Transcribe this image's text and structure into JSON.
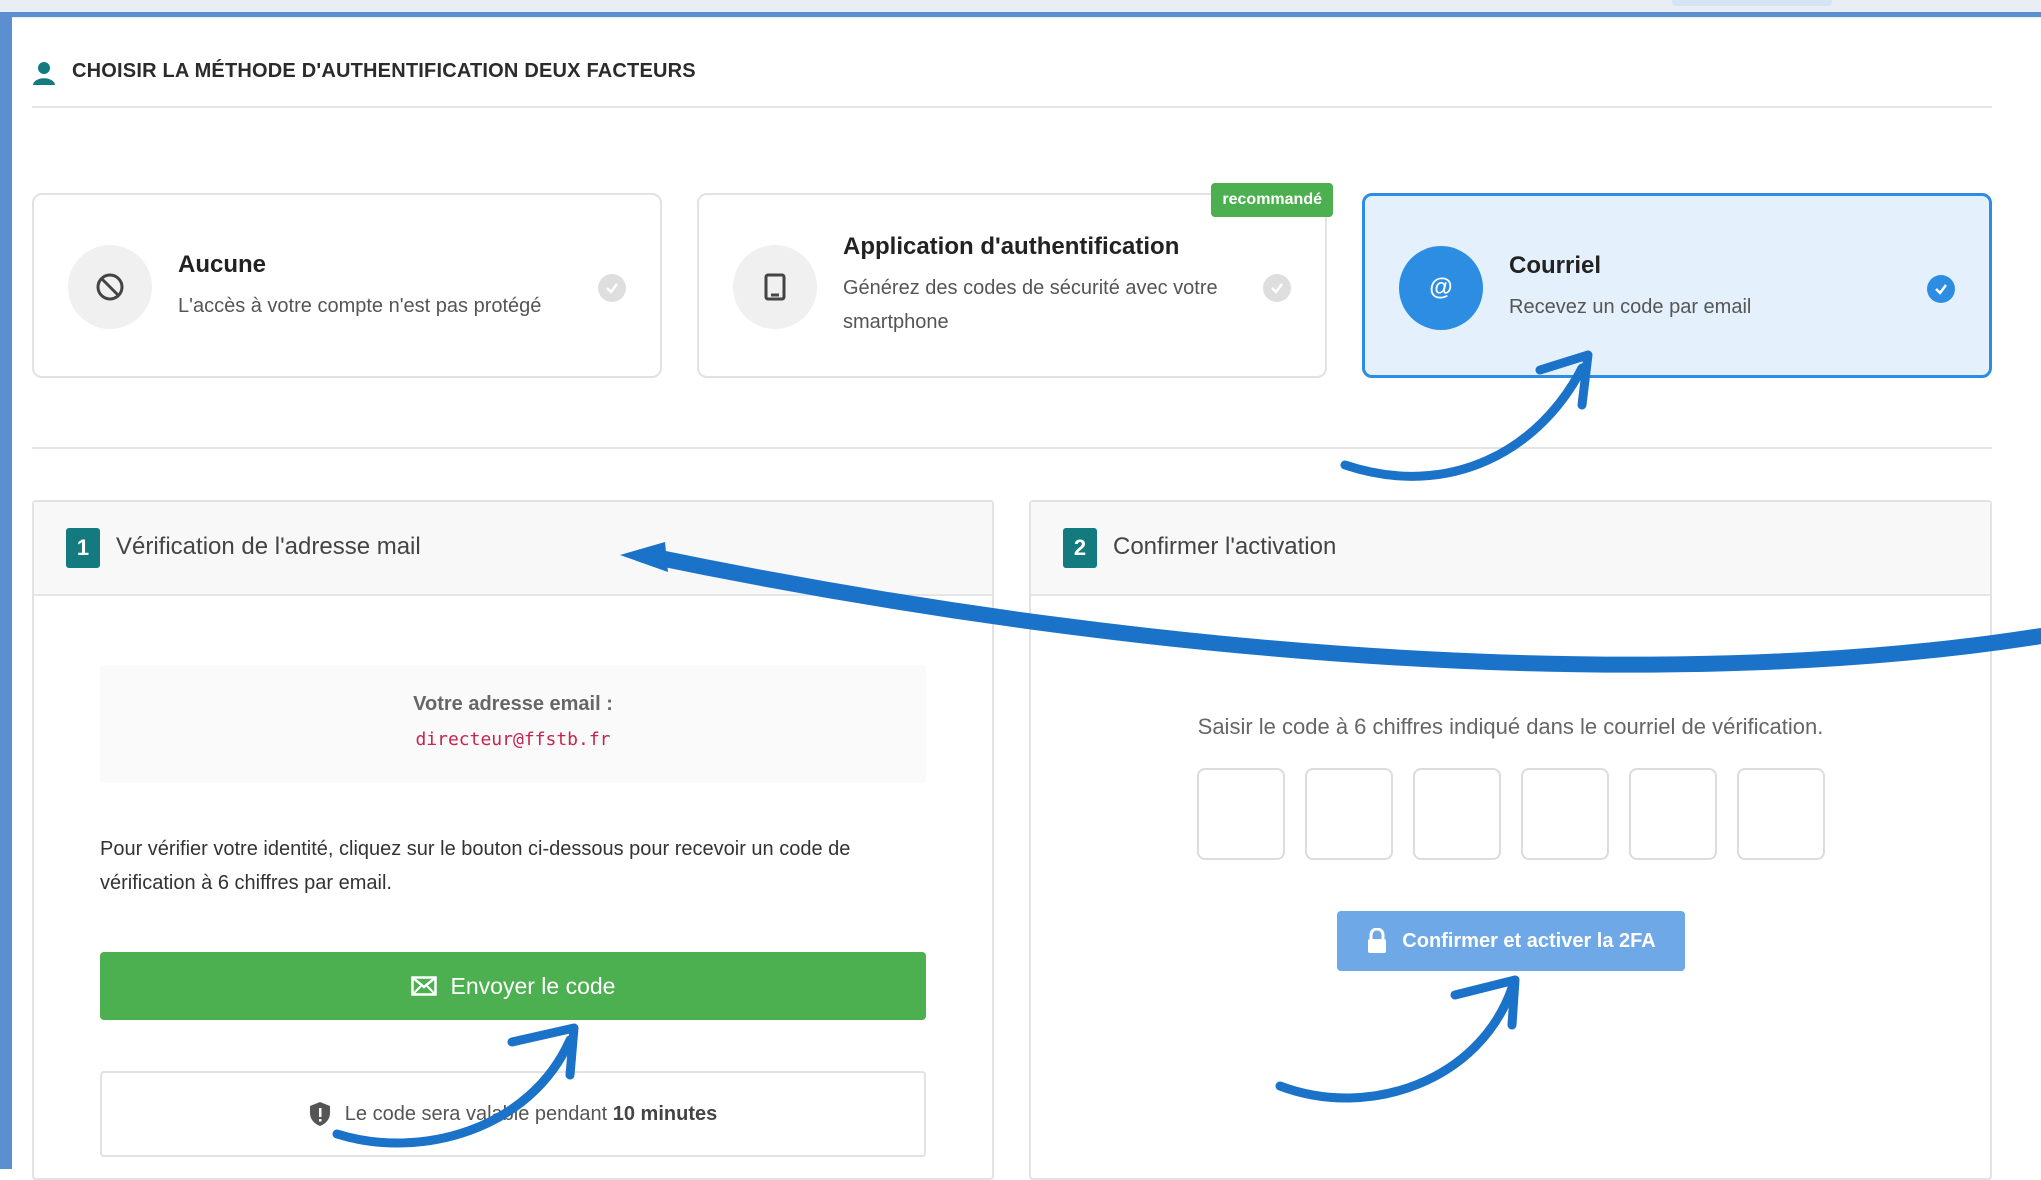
{
  "header": {
    "title": "CHOISIR LA MÉTHODE D'AUTHENTIFICATION DEUX FACTEURS",
    "icon": "user-icon"
  },
  "methods": [
    {
      "title": "Aucune",
      "description": "L'accès à votre compte n'est pas protégé",
      "icon": "ban-icon",
      "selected": false
    },
    {
      "title": "Application d'authentification",
      "description": "Générez des codes de sécurité avec votre smartphone",
      "icon": "tablet-icon",
      "badge": "recommandé",
      "selected": false
    },
    {
      "title": "Courriel",
      "description": "Recevez un code par email",
      "icon": "at-icon",
      "selected": true
    }
  ],
  "step1": {
    "number": "1",
    "title": "Vérification de l'adresse mail",
    "email_label": "Votre adresse email :",
    "email_value": "directeur@ffstb.fr",
    "instructions": "Pour vérifier votre identité, cliquez sur le bouton ci-dessous pour recevoir un code de vérification à 6 chiffres par email.",
    "send_button": "Envoyer le code",
    "validity_prefix": "Le code sera valable pendant",
    "validity_duration": "10 minutes"
  },
  "step2": {
    "number": "2",
    "title": "Confirmer l'activation",
    "instructions": "Saisir le code à 6 chiffres indiqué dans le courriel de vérification.",
    "code_digits": [
      "",
      "",
      "",
      "",
      "",
      ""
    ],
    "confirm_button": "Confirmer et activer la 2FA"
  },
  "colors": {
    "accent": "#2d8de3",
    "success": "#4caf50",
    "step": "#137a7f",
    "annotation": "#1a73c9"
  }
}
